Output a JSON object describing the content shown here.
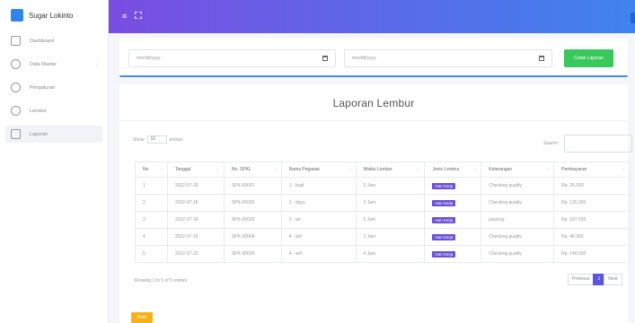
{
  "sidebar": {
    "brand": "Sugar Lokinto",
    "items": [
      {
        "label": "Dashboard",
        "icon": "home-icon"
      },
      {
        "label": "Data Master",
        "icon": "database-icon"
      },
      {
        "label": "Pengaturan",
        "icon": "settings-icon"
      },
      {
        "label": "Lembur",
        "icon": "user-icon"
      },
      {
        "label": "Laporan",
        "icon": "file-icon"
      }
    ]
  },
  "filter": {
    "date_from": "mm/dd/yyyy",
    "date_to": "mm/dd/yyyy",
    "submit_label": "Cetak Laporan"
  },
  "report": {
    "title": "Laporan Lembur",
    "show_prefix": "Show",
    "show_value": "10",
    "show_suffix": "entries",
    "search_label": "Search:",
    "columns": [
      "No",
      "Tanggal",
      "No. SPKL",
      "Nama Pegawai",
      "Waktu Lembur",
      "Jenis Lembur",
      "Keterangan",
      "Pembayaran"
    ],
    "rows": [
      [
        "1",
        "2022-07-18",
        "SPK-00001",
        "1 - budi",
        "2 Jam",
        "Hari Kerja",
        "Checking quality",
        "Rp. 25.000"
      ],
      [
        "2",
        "2022-07-18",
        "SPK-00002",
        "2 - dayu",
        "3 Jam",
        "Hari Kerja",
        "Checking quality",
        "Rp. 135.000"
      ],
      [
        "3",
        "2022-07-18",
        "SPK-00003",
        "3 - ari",
        "5 Jam",
        "Hari Kerja",
        "packing",
        "Rp. 187.500"
      ],
      [
        "4",
        "2022-07-19",
        "SPK-00004",
        "4 - arif",
        "1 Jam",
        "Hari Kerja",
        "Checking quality",
        "Rp. 46.000"
      ],
      [
        "5",
        "2022-07-22",
        "SPK-00005",
        "4 - arif",
        "4 Jam",
        "Hari Kerja",
        "Checking quality",
        "Rp. 148.000"
      ]
    ],
    "info": "Showing 1 to 5 of 5 entries",
    "pager": {
      "prev": "Previous",
      "page": "1",
      "next": "Next"
    },
    "print_label": "Print"
  },
  "colors": {
    "topbar_start": "#7a4de2",
    "topbar_end": "#3f83ee",
    "success": "#38c85b",
    "badge": "#6c4fd6",
    "warning": "#f7b219"
  }
}
